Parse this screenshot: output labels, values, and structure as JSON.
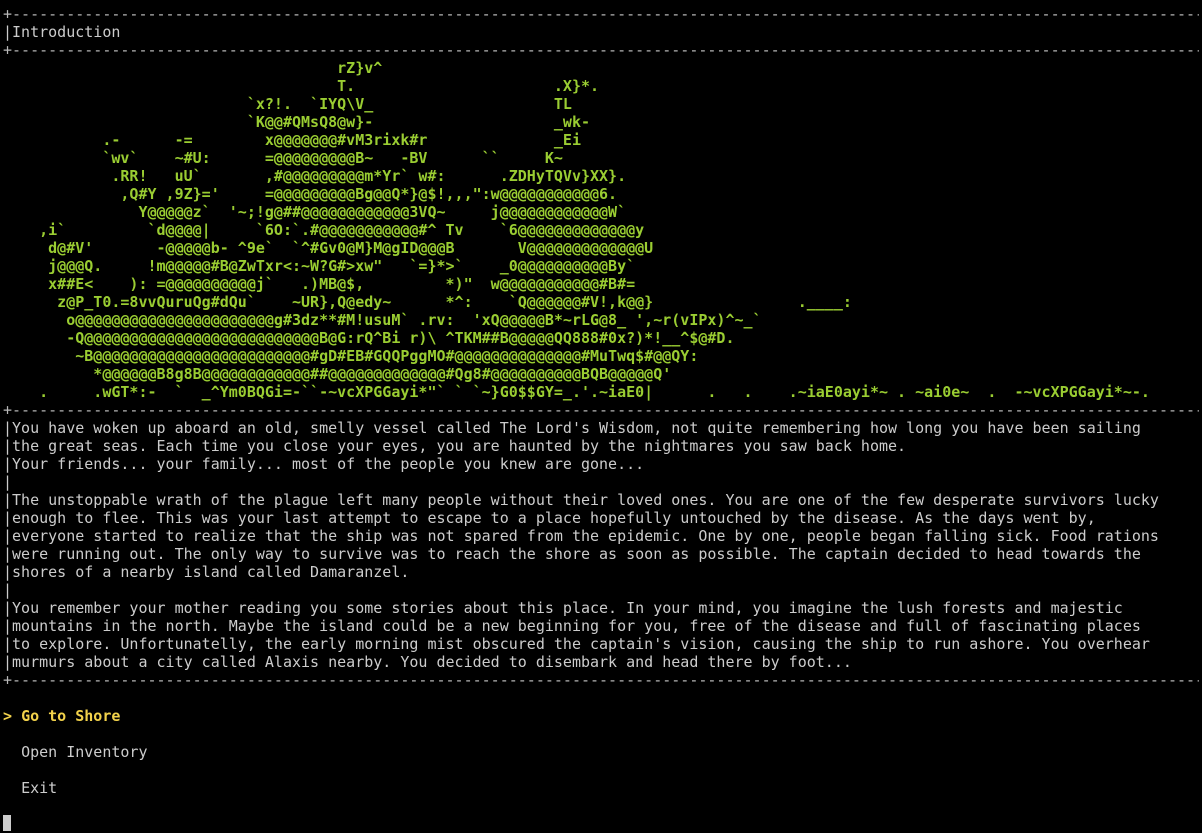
{
  "screen": {
    "title": "|Introduction",
    "border": "+--------------------------------------------------------------------------------------------------------------------------------------+"
  },
  "ascii_art": [
    "                                     rZ}v^",
    "                                     T.                      .X}*.",
    "                           `x?!.  `IYQ\\V_                    TL",
    "                           `K@@#QMsQ8@w}-                    _wk-",
    "           .-      -=        x@@@@@@@#vM3rixk#r              _Ei",
    "           `wv`    ~#U:      =@@@@@@@@@B~   -BV      ``     K~",
    "            .RR!   uU`       ,#@@@@@@@@@m*Yr` w#:      .ZDHyTQVv}XX}.",
    "             ,Q#Y ,9Z}='     =@@@@@@@@@Bg@@Q*}@$!,,,\":w@@@@@@@@@@@6.",
    "               Y@@@@@z`  '~;!g@##@@@@@@@@@@@@3VQ~     j@@@@@@@@@@@@W`",
    "    ,i`         `d@@@@|     `6O:`.#@@@@@@@@@@@#^ Tv    `6@@@@@@@@@@@@@y",
    "     d@#V'       -@@@@@b- ^9e`  `^#Gv0@M}M@gID@@@B       V@@@@@@@@@@@@@U",
    "     j@@@Q.     !m@@@@@#B@ZwTxr<:~W?G#>xw\"   `=}*>`    _0@@@@@@@@@@By`",
    "     x##E<    ): =@@@@@@@@@@j`   .)MB@$,         *)\"  w@@@@@@@@@@@#B#=",
    "      z@P_T0.=8vvQuruQg#dQu`    ~UR},Q@edy~      *^:    `Q@@@@@@#V!,k@@}                .____:",
    "       o@@@@@@@@@@@@@@@@@@@@@@g#3dz**#M!usuM` .rv:  'xQ@@@@@B*~rLG@8_ ',~r(vIPx)^~_`",
    "       -Q@@@@@@@@@@@@@@@@@@@@@@@@@@B@G:rQ^Bi r)\\ ^TKM##B@@@@@QQ888#0x?)*!__^$@#D.",
    "        ~B@@@@@@@@@@@@@@@@@@@@@@@@#gD#EB#GQQPggMO#@@@@@@@@@@@@@@#MuTwq$#@@QY:",
    "          *@@@@@@B8g8B@@@@@@@@@@@@##@@@@@@@@@@@@@#Qg8#@@@@@@@@@@BQB@@@@@Q'",
    "    .     .wGT*:-  `  _^Ym0BQGi=-``-~vcXPGGayi*\"` ` `~}G0$$GY=_.'.~iaE0|      .   .    .~iaE0ayi*~ . ~ai0e~  .  -~vcXPGGayi*~-."
  ],
  "story": [
    "|You have woken up aboard an old, smelly vessel called The Lord's Wisdom, not quite remembering how long you have been sailing",
    "|the great seas. Each time you close your eyes, you are haunted by the nightmares you saw back home.",
    "|Your friends... your family... most of the people you knew are gone...",
    "|",
    "|The unstoppable wrath of the plague left many people without their loved ones. You are one of the few desperate survivors lucky",
    "|enough to flee. This was your last attempt to escape to a place hopefully untouched by the disease. As the days went by,",
    "|everyone started to realize that the ship was not spared from the epidemic. One by one, people began falling sick. Food rations",
    "|were running out. The only way to survive was to reach the shore as soon as possible. The captain decided to head towards the",
    "|shores of a nearby island called Damaranzel.",
    "|",
    "|You remember your mother reading you some stories about this place. In your mind, you imagine the lush forests and majestic",
    "|mountains in the north. Maybe the island could be a new beginning for you, free of the disease and full of fascinating places",
    "|to explore. Unfortunatelly, the early morning mist obscured the captain's vision, causing the ship to run ashore. You overhear",
    "|murmurs about a city called Alaxis nearby. You decided to disembark and head there by foot..."
  ],
  "menu": {
    "selected_prefix": "> ",
    "items": [
      {
        "label": "Go to Shore",
        "selected": true
      },
      {
        "label": "Open Inventory",
        "selected": false
      },
      {
        "label": "Exit",
        "selected": false
      }
    ]
  },
  "colors": {
    "background": "#000000",
    "art": "#9acd32",
    "text": "#cccccc",
    "selected": "#f2d24b"
  }
}
